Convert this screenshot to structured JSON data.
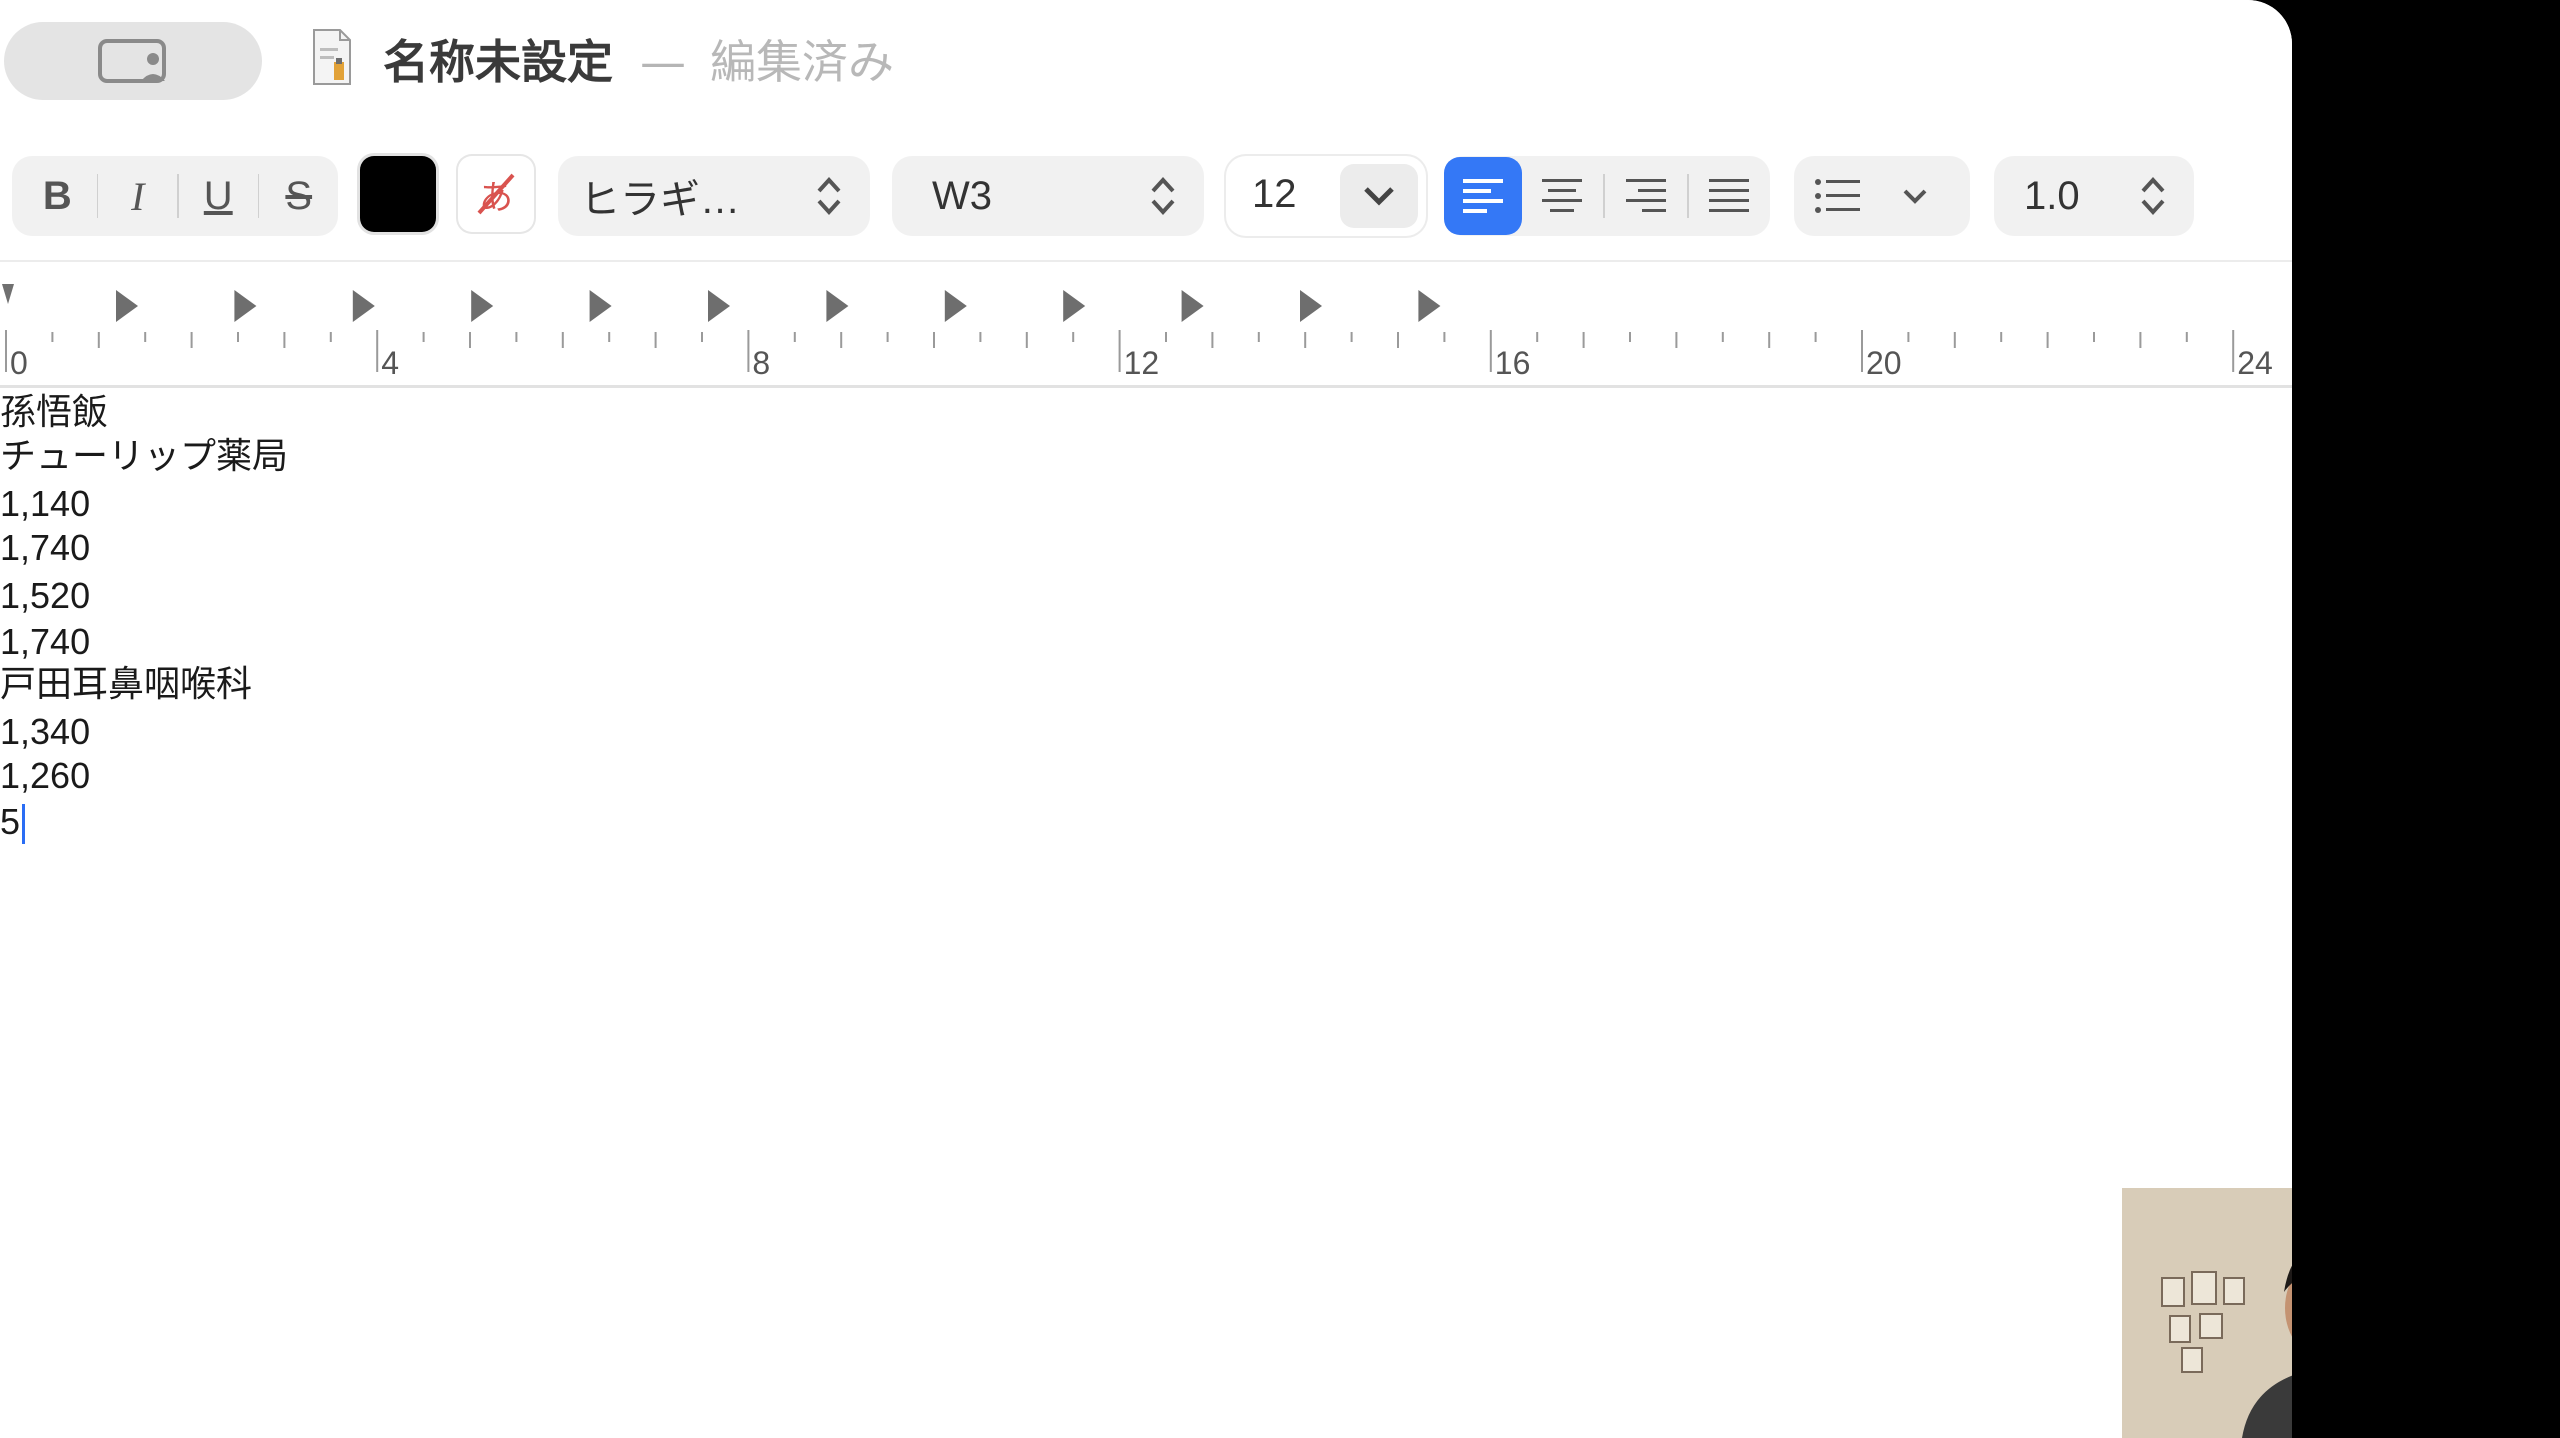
{
  "window": {
    "title": "名称未設定",
    "separator": "—",
    "status": "編集済み"
  },
  "toolbar": {
    "bold": "B",
    "italic": "I",
    "underline": "U",
    "strikethrough": "S",
    "text_color": "#000000",
    "font_family": "ヒラギ…",
    "font_weight": "W3",
    "font_size": "12",
    "accent_color": "#3478f6",
    "line_spacing": "1.0"
  },
  "ruler": {
    "tick_labels": [
      "0",
      "4",
      "8",
      "12",
      "16",
      "20",
      "24"
    ]
  },
  "document": {
    "lines": [
      "孫悟飯",
      "チューリップ薬局",
      "1,140",
      "1,740",
      "1,520",
      "1,740",
      "戸田耳鼻咽喉科",
      "1,340",
      "1,260",
      "5"
    ]
  },
  "icons": [
    "sidebar-toggle-icon",
    "document-icon",
    "clear-style-icon",
    "up-down-icon",
    "chevron-down-icon",
    "align-left-icon",
    "align-center-icon",
    "align-right-icon",
    "justify-icon",
    "list-icon",
    "tab-stop-icon"
  ]
}
